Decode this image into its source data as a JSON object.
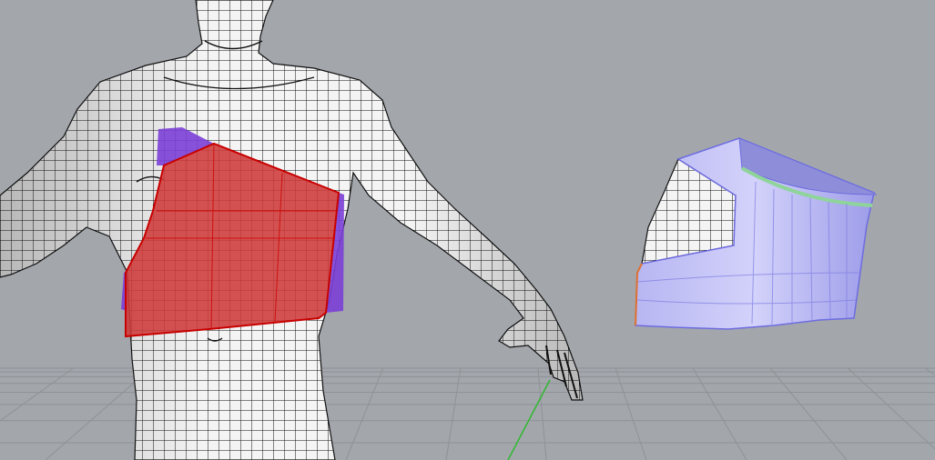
{
  "viewport": {
    "background": "#a3a7ac",
    "grid_color": "#8e9297",
    "axis_y_color": "#2fb82f",
    "mesh_fill": "#f2f2f2",
    "mesh_line": "#111111",
    "red_patch_fill": "#cf3a3a",
    "red_patch_edge": "#c80000",
    "purple_patch_fill": "#7b3fd6",
    "lavender_fill": "#a9a8ef",
    "lavender_edge": "#6d6ce0",
    "green_edge": "#8fd49a"
  }
}
